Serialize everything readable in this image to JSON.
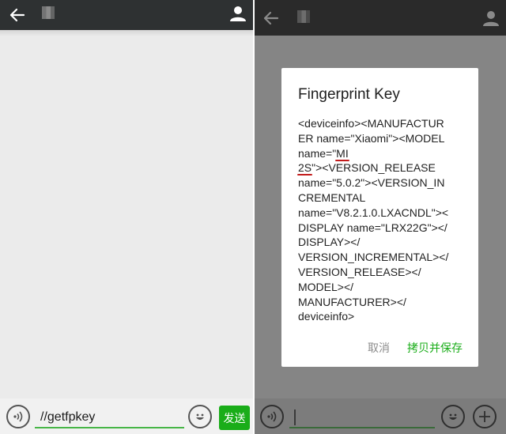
{
  "left_screen": {
    "input_value": "//getfpkey",
    "send_label": "发送"
  },
  "dialog": {
    "title": "Fingerprint Key",
    "lines": [
      "<deviceinfo><MANUFACTUR",
      "ER name=\"Xiaomi\"><MODEL",
      "name=\"",
      "MI",
      "2S",
      "\"><VERSION_RELEASE",
      "name=\"5.0.2\"><VERSION_IN",
      "CREMENTAL",
      "name=\"V8.2.1.0.LXACNDL\"><",
      "DISPLAY name=\"LRX22G\"></",
      "DISPLAY></",
      "VERSION_INCREMENTAL></",
      "VERSION_RELEASE></",
      "MODEL></",
      "MANUFACTURER></",
      "deviceinfo>"
    ],
    "cancel_label": "取消",
    "save_label": "拷贝并保存"
  },
  "colors": {
    "accent_green": "#1aad19",
    "topbar": "#2e3132",
    "highlight_red": "#c21b1b"
  },
  "icons": [
    "back-arrow-icon",
    "pixelated-avatar",
    "person-icon",
    "voice-icon",
    "emoji-icon",
    "plus-icon"
  ]
}
